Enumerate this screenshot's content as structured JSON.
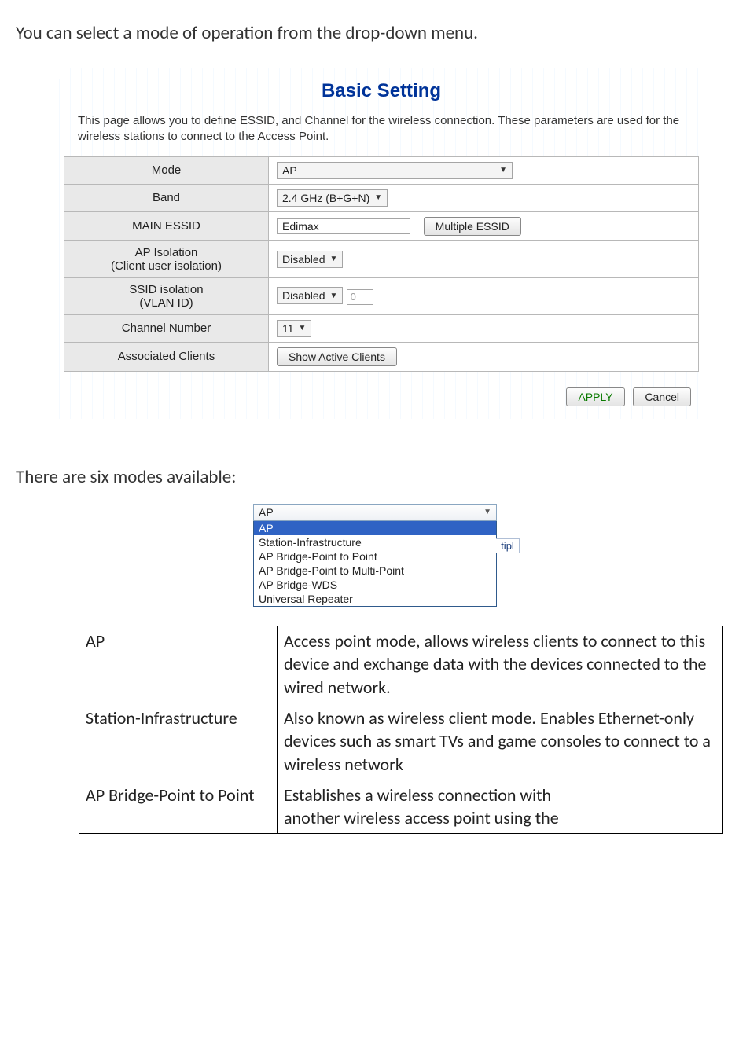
{
  "doc": {
    "intro": "You can select a mode of operation from the drop-down menu.",
    "modes_intro": "There are six modes available:"
  },
  "panel": {
    "title": "Basic Setting",
    "description": "This page allows you to define ESSID, and Channel for the wireless connection. These parameters are used for the wireless stations to connect to the Access Point.",
    "rows": {
      "mode": {
        "label": "Mode",
        "value": "AP"
      },
      "band": {
        "label": "Band",
        "value": "2.4 GHz (B+G+N)"
      },
      "main_essid": {
        "label": "MAIN ESSID",
        "value": "Edimax",
        "button": "Multiple ESSID"
      },
      "ap_isolation": {
        "label_line1": "AP Isolation",
        "label_line2": "(Client user isolation)",
        "value": "Disabled"
      },
      "ssid_isolation": {
        "label_line1": "SSID isolation",
        "label_line2": "(VLAN ID)",
        "value": "Disabled",
        "vlan": "0"
      },
      "channel": {
        "label": "Channel Number",
        "value": "11"
      },
      "clients": {
        "label": "Associated Clients",
        "button": "Show Active Clients"
      }
    },
    "apply": "APPLY",
    "cancel": "Cancel"
  },
  "dropdown": {
    "selected": "AP",
    "items": [
      "AP",
      "Station-Infrastructure",
      "AP Bridge-Point to Point",
      "AP Bridge-Point to Multi-Point",
      "AP Bridge-WDS",
      "Universal Repeater"
    ],
    "side": "tipl"
  },
  "table": {
    "r1": {
      "k": "AP",
      "v": "Access point mode, allows wireless clients to connect to this device and exchange data with the devices connected to the wired network."
    },
    "r2": {
      "k": "Station-Infrastructure",
      "v": "Also known as wireless client mode. Enables Ethernet-only devices such as smart TVs and game consoles to connect to a wireless network"
    },
    "r3": {
      "k": "AP Bridge-Point to Point",
      "v_l1": "Establishes a wireless connection with",
      "v_l2": "another wireless access point using the"
    }
  }
}
